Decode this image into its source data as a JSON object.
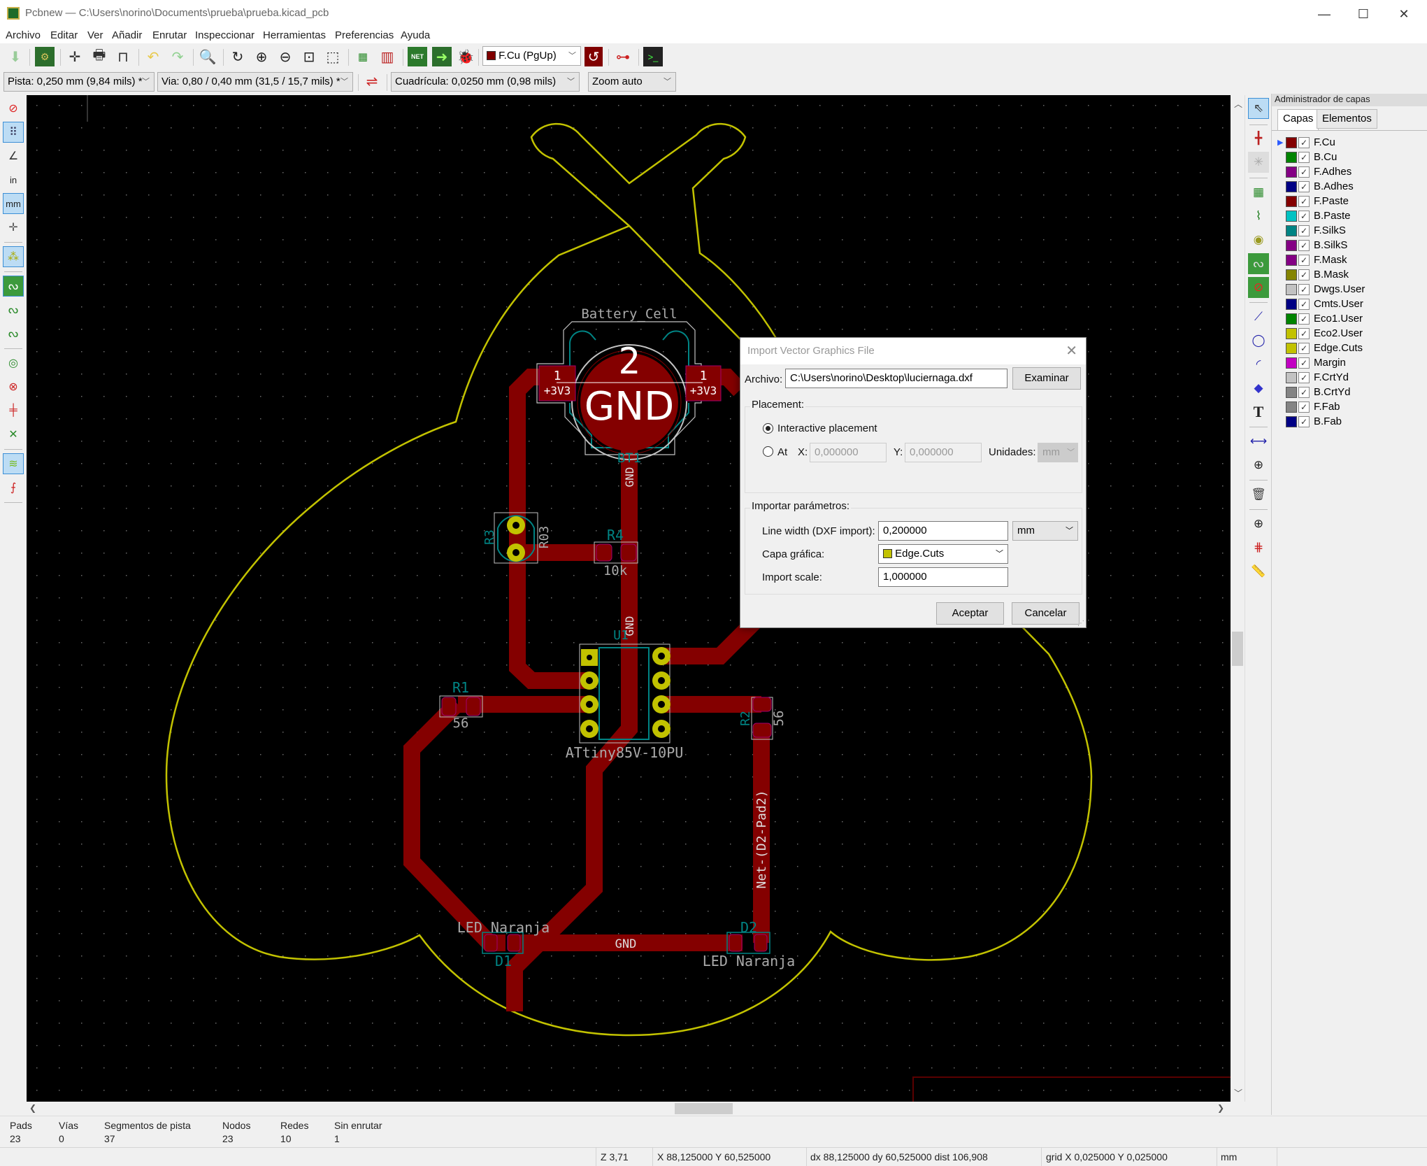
{
  "window": {
    "title": "Pcbnew — C:\\Users\\norino\\Documents\\prueba\\prueba.kicad_pcb",
    "minimize_glyph": "—",
    "maximize_glyph": "☐",
    "close_glyph": "✕"
  },
  "menu": [
    "Archivo",
    "Editar",
    "Ver",
    "Añadir",
    "Enrutar",
    "Inspeccionar",
    "Herramientas",
    "Preferencias",
    "Ayuda"
  ],
  "toolbar_top": {
    "icons": [
      "save-icon",
      "board-setup-icon",
      "page-settings-icon",
      "print-icon",
      "plot-icon",
      "undo-icon",
      "redo-icon",
      "find-icon",
      "redraw-icon",
      "zoom-in-icon",
      "zoom-out-icon",
      "zoom-fit-icon",
      "zoom-selection-icon",
      "footprint-editor-icon",
      "footprint-browser-icon",
      "netlist-icon",
      "update-pcb-icon",
      "drc-icon",
      "via-layer-pair-icon",
      "schematic-icon",
      "scripting-console-icon"
    ],
    "layer_select": "F.Cu (PgUp)",
    "layer_color": "#800000"
  },
  "toolbar_second": {
    "track_width": "Pista: 0,250 mm (9,84 mils) *",
    "via_size": "Via: 0,80 / 0,40 mm (31,5 / 15,7 mils) *",
    "grid": "Cuadrícula: 0,0250 mm (0,98 mils)",
    "zoom": "Zoom auto"
  },
  "left_toolbar": [
    "drc-off-icon",
    "grid-icon",
    "polar-coords-icon",
    "inch-units-icon",
    "mm-units-icon",
    "cursor-shape-icon",
    "ratsnest-icon",
    "zone-fill-icon",
    "zone-outline-icon",
    "zone-unfilled-icon",
    "pad-sketch-icon",
    "via-sketch-icon",
    "track-sketch-icon",
    "high-contrast-icon",
    "layers-manager-icon",
    "microwave-icon"
  ],
  "right_toolbar": [
    "select-icon",
    "highlight-net-icon",
    "local-ratsnest-icon",
    "add-footprint-icon",
    "route-track-icon",
    "add-via-icon",
    "add-zone-icon",
    "keepout-icon",
    "add-line-icon",
    "add-circle-icon",
    "add-arc-icon",
    "add-polygon-icon",
    "add-text-icon",
    "add-dimension-icon",
    "add-target-icon",
    "delete-icon",
    "place-origin-icon",
    "grid-origin-icon",
    "measure-icon"
  ],
  "layer_manager": {
    "title": "Administrador de capas",
    "tabs": [
      "Capas",
      "Elementos"
    ],
    "active_tab": "Capas",
    "layers": [
      {
        "name": "F.Cu",
        "color": "#840000",
        "visible": true,
        "active": true
      },
      {
        "name": "B.Cu",
        "color": "#008400",
        "visible": true
      },
      {
        "name": "F.Adhes",
        "color": "#840084",
        "visible": true
      },
      {
        "name": "B.Adhes",
        "color": "#000084",
        "visible": true
      },
      {
        "name": "F.Paste",
        "color": "#840000",
        "visible": true
      },
      {
        "name": "B.Paste",
        "color": "#00c2c2",
        "visible": true
      },
      {
        "name": "F.SilkS",
        "color": "#008484",
        "visible": true
      },
      {
        "name": "B.SilkS",
        "color": "#840084",
        "visible": true
      },
      {
        "name": "F.Mask",
        "color": "#840084",
        "visible": true
      },
      {
        "name": "B.Mask",
        "color": "#848400",
        "visible": true
      },
      {
        "name": "Dwgs.User",
        "color": "#c2c2c2",
        "visible": true
      },
      {
        "name": "Cmts.User",
        "color": "#000084",
        "visible": true
      },
      {
        "name": "Eco1.User",
        "color": "#008400",
        "visible": true
      },
      {
        "name": "Eco2.User",
        "color": "#c2c200",
        "visible": true
      },
      {
        "name": "Edge.Cuts",
        "color": "#c2c200",
        "visible": true
      },
      {
        "name": "Margin",
        "color": "#c200c2",
        "visible": true
      },
      {
        "name": "F.CrtYd",
        "color": "#c2c2c2",
        "visible": true
      },
      {
        "name": "B.CrtYd",
        "color": "#848484",
        "visible": true
      },
      {
        "name": "F.Fab",
        "color": "#848484",
        "visible": true
      },
      {
        "name": "B.Fab",
        "color": "#000084",
        "visible": true
      }
    ]
  },
  "pcb": {
    "colors": {
      "track": "#840000",
      "edge": "#c2c200",
      "pad_th": "#c2c200",
      "silk": "#008484",
      "fab": "#aaaaaa",
      "crtyd": "#c2c2c2"
    },
    "labels": {
      "battery_value": "Battery_Cell",
      "battery_pad_big_num": "2",
      "battery_pad_big_net": "GND",
      "battery_pad_num": "1",
      "battery_pad_net": "+3V3",
      "battery_ref": "BT1",
      "r3_ref": "R3",
      "r3_value": "R03",
      "r4_ref": "R4",
      "r4_value": "10k",
      "u1_ref": "U1",
      "u1_value": "ATtiny85V-10PU",
      "r1_ref": "R1",
      "r1_value": "56",
      "r2_ref": "R2",
      "r2_value": "56",
      "d1_ref": "D1",
      "d1_value": "LED Naranja",
      "d2_ref": "D2",
      "d2_value": "LED Naranja",
      "net_gnd": "GND",
      "net_d2": "Net-(D2-Pad2)"
    }
  },
  "dialog": {
    "title": "Import Vector Graphics File",
    "file_label": "Archivo:",
    "file_value": "C:\\Users\\norino\\Desktop\\luciernaga.dxf",
    "browse": "Examinar",
    "placement_group": "Placement:",
    "interactive": "Interactive placement",
    "at": "At",
    "x_label": "X:",
    "x_value": "0,000000",
    "y_label": "Y:",
    "y_value": "0,000000",
    "units_label": "Unidades:",
    "units_value": "mm",
    "params_group": "Importar parámetros:",
    "line_width_label": "Line width (DXF import):",
    "line_width_value": "0,200000",
    "line_width_units": "mm",
    "layer_label": "Capa gráfica:",
    "layer_value": "Edge.Cuts",
    "layer_color": "#c2c200",
    "scale_label": "Import scale:",
    "scale_value": "1,000000",
    "ok": "Aceptar",
    "cancel": "Cancelar",
    "placement_mode": "interactive"
  },
  "stats": [
    {
      "label": "Pads",
      "value": "23"
    },
    {
      "label": "Vías",
      "value": "0"
    },
    {
      "label": "Segmentos de pista",
      "value": "37"
    },
    {
      "label": "Nodos",
      "value": "23"
    },
    {
      "label": "Redes",
      "value": "10"
    },
    {
      "label": "Sin enrutar",
      "value": "1"
    }
  ],
  "status": {
    "zoom": "Z 3,71",
    "abs": "X 88,125000  Y 60,525000",
    "rel": "dx 88,125000  dy 60,525000  dist 106,908",
    "grid": "grid X 0,025000  Y 0,025000",
    "units": "mm"
  }
}
